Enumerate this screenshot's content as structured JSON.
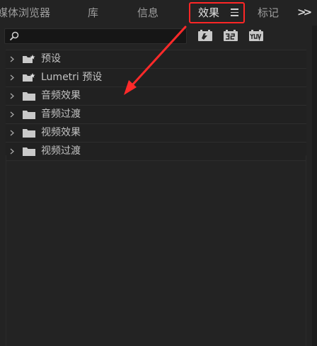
{
  "tabs": {
    "media_browser": "媒体浏览器",
    "libraries": "库",
    "info": "信息",
    "effects": "效果",
    "markers": "标记"
  },
  "search": {
    "placeholder": ""
  },
  "tools": [
    "accelerated-effects-icon",
    "32bit-effects-icon",
    "yuv-effects-icon"
  ],
  "tree": {
    "items": [
      {
        "label": "预设",
        "icon": "preset-folder-icon"
      },
      {
        "label": "Lumetri 预设",
        "icon": "preset-folder-icon"
      },
      {
        "label": "音频效果",
        "icon": "folder-icon"
      },
      {
        "label": "音频过渡",
        "icon": "folder-icon"
      },
      {
        "label": "视频效果",
        "icon": "folder-icon"
      },
      {
        "label": "视频过渡",
        "icon": "folder-icon"
      }
    ]
  },
  "colors": {
    "background": "#232323",
    "highlight_box": "#ff2626",
    "annotation_arrow": "#ff2a2a"
  }
}
